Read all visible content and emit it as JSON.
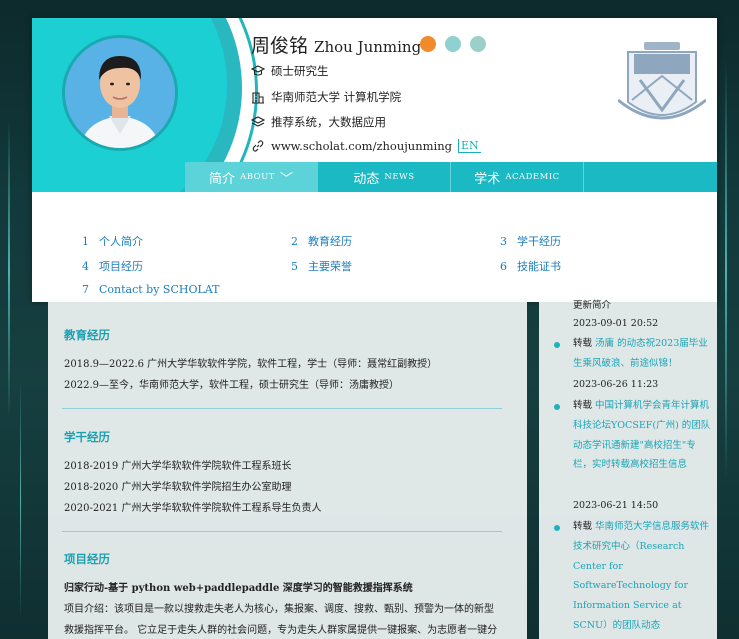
{
  "profile": {
    "name_cn": "周俊铭",
    "name_en": "Zhou Junming",
    "degree": "硕士研究生",
    "school": "华南师范大学 计算机学院",
    "research": "推荐系统，大数据应用",
    "url": "www.scholat.com/zhoujunming",
    "lang_switch": "EN",
    "logo_text": "華南師範大學"
  },
  "nav": [
    {
      "cn": "简介",
      "en": "ABOUT",
      "arrow": "﹀"
    },
    {
      "cn": "动态",
      "en": "NEWS"
    },
    {
      "cn": "学术",
      "en": "ACADEMIC"
    }
  ],
  "toc": [
    {
      "num": "1",
      "label": "个人简介"
    },
    {
      "num": "2",
      "label": "教育经历"
    },
    {
      "num": "3",
      "label": "学干经历"
    },
    {
      "num": "4",
      "label": "项目经历"
    },
    {
      "num": "5",
      "label": "主要荣誉"
    },
    {
      "num": "6",
      "label": "技能证书"
    },
    {
      "num": "7",
      "label": "Contact by SCHOLAT"
    }
  ],
  "education": {
    "title": "教育经历",
    "lines": [
      "2018.9—2022.6 广州大学华软软件学院，软件工程，学士（导师：聂常红副教授）",
      "2022.9—至今，华南师范大学，软件工程，硕士研究生（导师：汤庸教授）"
    ]
  },
  "student_work": {
    "title": "学干经历",
    "lines": [
      "2018-2019 广州大学华软软件学院软件工程系班长",
      "2018-2020 广州大学华软软件学院招生办公室助理",
      "2020-2021 广州大学华软软件学院软件工程系导生负责人"
    ]
  },
  "projects": {
    "title": "项目经历",
    "project_title": "归家行动-基于 python web+paddlepaddle 深度学习的智能救援指挥系统",
    "lines": [
      "项目介绍：该项目是一款以搜救走失老人为核心，集报案、调度、搜救、甄别、预警为一体的新型",
      "救援指挥平台。 它立足于走失人群的社会问题，专为走失人群家属提供一键报案、为志愿者一键分"
    ]
  },
  "feed": {
    "top_partial": "更新简介",
    "top_date": "2023-09-01 20:52",
    "items": [
      {
        "prefix": "转载",
        "text": "汤庸 的动态祝2023届毕业生乘风破浪、前途似锦！",
        "date": "2023-06-26 11:23"
      },
      {
        "prefix": "转载",
        "text": "中国计算机学会青年计算机科技论坛YOCSEF(广州) 的团队动态学讯通新建\"高校招生\"专栏，实时转载高校招生信息",
        "date": "2023-06-21 14:50"
      },
      {
        "prefix": "转载",
        "text": "华南师范大学信息服务软件技术研究中心（Research Center for SoftwareTechnology for Information Service at SCNU）的团队动态"
      }
    ]
  }
}
